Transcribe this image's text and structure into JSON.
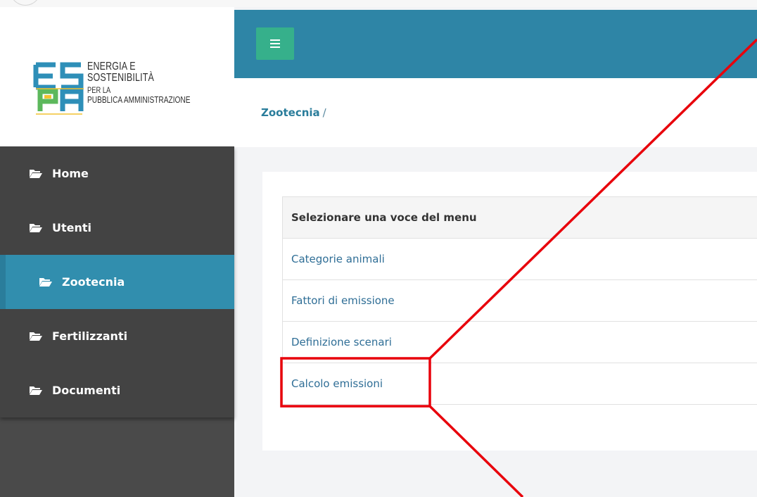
{
  "logo": {
    "line1": "ENERGIA E SOSTENIBILITÀ",
    "line2": "PER LA",
    "line3": "PUBBLICA AMMINISTRAZIONE"
  },
  "sidebar": {
    "items": [
      {
        "label": "Home",
        "icon": "folder-open-icon",
        "active": false
      },
      {
        "label": "Utenti",
        "icon": "folder-open-icon",
        "active": false
      },
      {
        "label": "Zootecnia",
        "icon": "folder-open-icon",
        "active": true
      },
      {
        "label": "Fertilizzanti",
        "icon": "folder-open-icon",
        "active": false
      },
      {
        "label": "Documenti",
        "icon": "folder-open-icon",
        "active": false
      }
    ]
  },
  "topbar": {
    "menu_toggle_icon": "hamburger-icon"
  },
  "breadcrumb": {
    "current": "Zootecnia",
    "separator": "/"
  },
  "menu_table": {
    "header": "Selezionare una voce del menu",
    "items": [
      "Categorie animali",
      "Fattori di emissione",
      "Definizione scenari",
      "Calcolo emissioni"
    ]
  },
  "colors": {
    "sidebar_bg": "#434343",
    "active_item": "#318eae",
    "topbar": "#2e85a6",
    "toggle_button": "#36b08b",
    "link": "#2f6e96",
    "annotation": "#e8000b"
  }
}
